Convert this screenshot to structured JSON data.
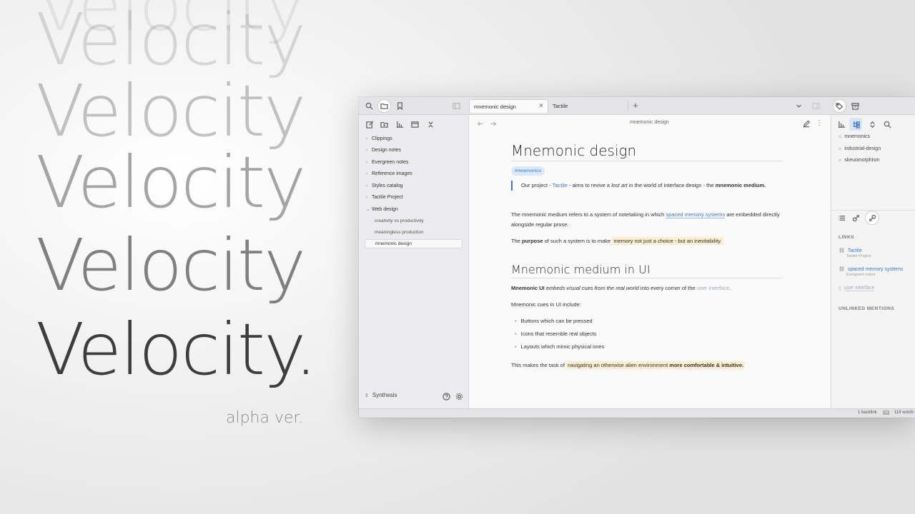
{
  "hero": {
    "word_faded": "Velocity",
    "word_main": "Velocity.",
    "subtitle": "alpha ver."
  },
  "app": {
    "tabs": [
      {
        "label": "mnemonic design",
        "active": true
      },
      {
        "label": "Tactile",
        "active": false
      }
    ],
    "sidebar": {
      "folders": [
        "Clippings",
        "Design notes",
        "Evergreen notes",
        "Reference images",
        "Styles catalog",
        "Tactile Project",
        "Web design"
      ],
      "notes": [
        "creativity vs productivity",
        "meaningless production",
        "mnemonic design"
      ],
      "vault_name": "Synthesis"
    },
    "editor": {
      "header_title": "mnemonic design",
      "title": "Mnemonic design",
      "tag": "#mnemonics",
      "quote": {
        "p1": "Our project - ",
        "link": "Tactile",
        "p2": " - aims to revive a ",
        "em": "lost art",
        "p3": " in the world of interface design - the ",
        "strong": "mnemonic medium."
      },
      "para1": {
        "p1": "The mnemonic medium refers to a system of notetaking in which ",
        "link": "spaced memory systems",
        "p2": " are embedded directly alongside regular prose."
      },
      "para2": {
        "p1": "The ",
        "strong": "purpose",
        "p2": " of such a system is to make ",
        "hl": "memory not just a choice - but an inevitability."
      },
      "subtitle": "Mnemonic medium in UI",
      "para3": {
        "strong": "Mnemonic UI",
        "em": " embeds visual cues from the real world",
        "p1": " into every corner of the ",
        "link": "user interface",
        "p2": "."
      },
      "para4": "Mnemonic cues in UI include:",
      "bullets": [
        "Buttons which can be pressed",
        "Icons that resemble real objects",
        "Layouts which mimic physical ones"
      ],
      "para5": {
        "p1": "This makes the task of ",
        "hl1": "navigating an otherwise alien environment",
        "hl2": " more comfortable & intuitive."
      }
    },
    "right_panel": {
      "tags": [
        "mnemonics",
        "industrial-design",
        "skeuomorphism"
      ],
      "links_heading": "LINKS",
      "links": [
        {
          "title": "Tactile",
          "sub": "Tactile Project"
        },
        {
          "title": "spaced memory systems",
          "sub": "Evergreen notes"
        },
        {
          "title": "user interface",
          "sub": ""
        }
      ],
      "unlinked_heading": "UNLINKED MENTIONS"
    },
    "status": {
      "backlinks": "1 backlink",
      "words": "118 words"
    }
  },
  "colors": {
    "accent": "#3b78c8",
    "highlight": "#fbeed0"
  }
}
